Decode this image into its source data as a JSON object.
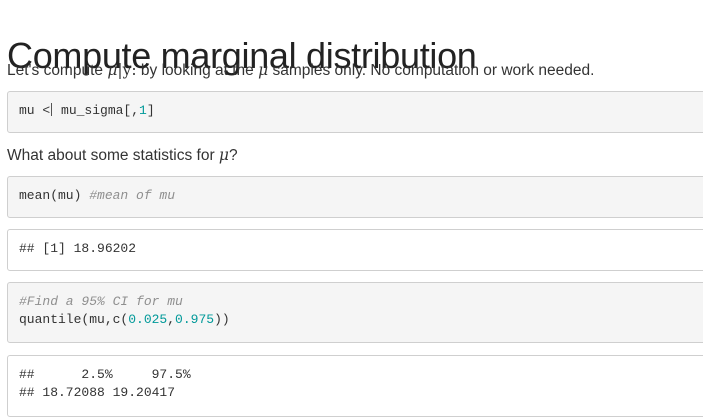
{
  "heading": "Compute marginal distribution",
  "para1": {
    "prefix": "Let's compute ",
    "mu": "μ",
    "given": "|y:",
    "middle": " by looking at the ",
    "mu2": "μ",
    "suffix": " samples only. No computation or work needed."
  },
  "code1": {
    "a": "mu <",
    "b": " mu_sigma[,",
    "c": "1",
    "d": "]"
  },
  "para2": {
    "prefix": "What about some statistics for ",
    "mu": "μ",
    "suffix": "?"
  },
  "code2": {
    "expr": "mean(mu) ",
    "comment": "#mean of mu"
  },
  "out1": {
    "text": "## [1] 18.96202"
  },
  "code3": {
    "comment": "#Find a 95% CI for mu",
    "a": "quantile(mu,c(",
    "n1": "0.025",
    "sep": ",",
    "n2": "0.975",
    "b": "))"
  },
  "out2": {
    "line1": "##      2.5%     97.5%",
    "line2": "## 18.72088 19.20417"
  }
}
